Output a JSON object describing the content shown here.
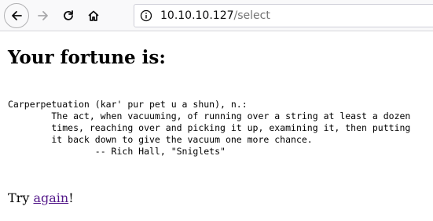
{
  "browser": {
    "icons": {
      "back": "arrow-left-icon",
      "forward": "arrow-right-icon",
      "reload": "reload-icon",
      "home": "home-icon",
      "info": "info-circle-icon"
    },
    "url_host": "10.10.10.127",
    "url_path": "/select"
  },
  "page": {
    "heading": "Your fortune is:",
    "fortune_lines": [
      "Carperpetuation (kar' pur pet u a shun), n.:",
      "        The act, when vacuuming, of running over a string at least a dozen",
      "        times, reaching over and picking it up, examining it, then putting",
      "        it back down to give the vacuum one more chance.",
      "                -- Rich Hall, \"Sniglets\""
    ],
    "try_prefix": "Try ",
    "again_link": "again",
    "try_suffix": "!"
  },
  "colors": {
    "link_visited": "#551a8b",
    "toolbar_bg": "#f9f9fa",
    "url_path": "#737373"
  }
}
